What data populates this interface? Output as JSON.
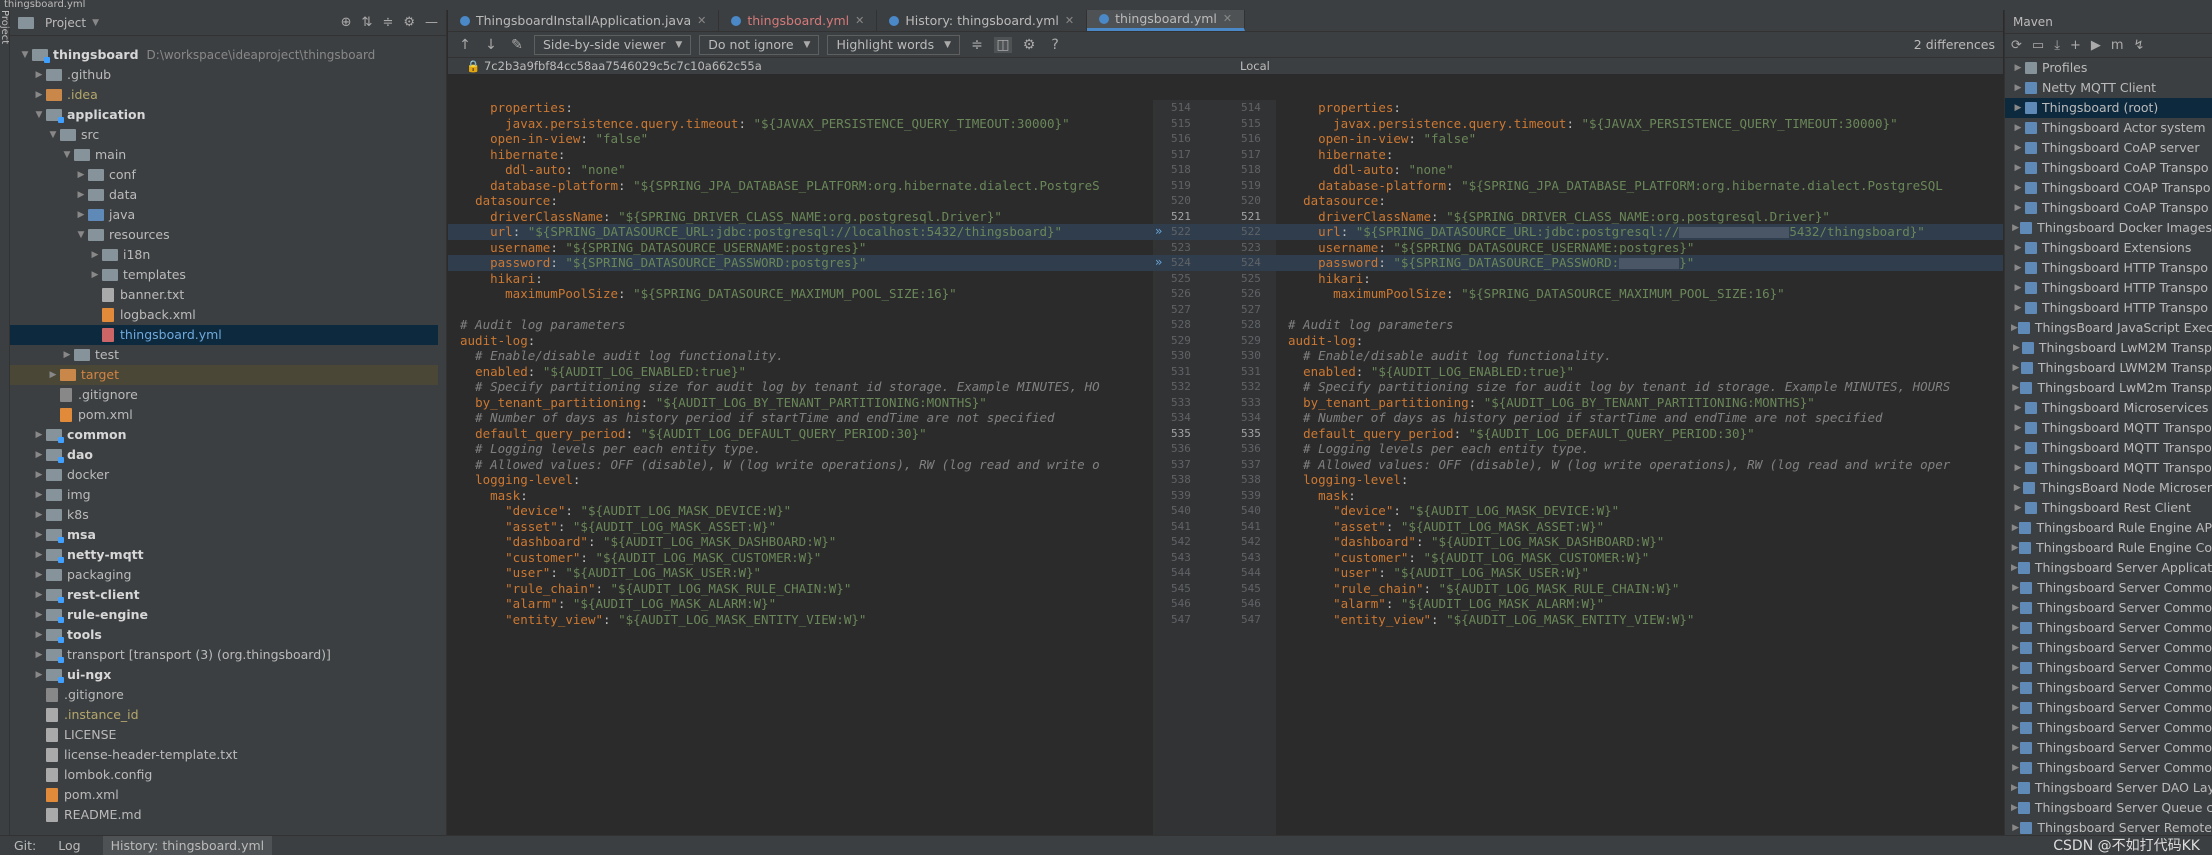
{
  "window": {
    "title": "thingsboard.yml",
    "left_strip": "Project"
  },
  "project": {
    "title": "Project",
    "tree": [
      {
        "depth": 0,
        "arrow": "v",
        "icon": "mod",
        "label": "thingsboard",
        "path": "D:\\workspace\\ideaproject\\thingsboard",
        "style": "bold"
      },
      {
        "depth": 1,
        "arrow": ">",
        "icon": "fold",
        "label": ".github"
      },
      {
        "depth": 1,
        "arrow": ">",
        "icon": "orange",
        "label": ".idea",
        "style": "olive"
      },
      {
        "depth": 1,
        "arrow": "v",
        "icon": "mod",
        "label": "application",
        "style": "bold"
      },
      {
        "depth": 2,
        "arrow": "v",
        "icon": "fold",
        "label": "src"
      },
      {
        "depth": 3,
        "arrow": "v",
        "icon": "fold",
        "label": "main"
      },
      {
        "depth": 4,
        "arrow": ">",
        "icon": "fold",
        "label": "conf"
      },
      {
        "depth": 4,
        "arrow": ">",
        "icon": "fold",
        "label": "data"
      },
      {
        "depth": 4,
        "arrow": ">",
        "icon": "blue",
        "label": "java"
      },
      {
        "depth": 4,
        "arrow": "v",
        "icon": "fold",
        "label": "resources"
      },
      {
        "depth": 5,
        "arrow": ">",
        "icon": "fold",
        "label": "i18n"
      },
      {
        "depth": 5,
        "arrow": ">",
        "icon": "fold",
        "label": "templates"
      },
      {
        "depth": 5,
        "arrow": "",
        "icon": "txt",
        "label": "banner.txt"
      },
      {
        "depth": 5,
        "arrow": "",
        "icon": "xml",
        "label": "logback.xml"
      },
      {
        "depth": 5,
        "arrow": "",
        "icon": "yml",
        "label": "thingsboard.yml",
        "style": "blue-t",
        "selected": true
      },
      {
        "depth": 3,
        "arrow": ">",
        "icon": "fold",
        "label": "test"
      },
      {
        "depth": 2,
        "arrow": ">",
        "icon": "orange",
        "label": "target",
        "style": "orange-t",
        "target": true
      },
      {
        "depth": 2,
        "arrow": "",
        "icon": "git",
        "label": ".gitignore"
      },
      {
        "depth": 2,
        "arrow": "",
        "icon": "xml",
        "label": "pom.xml"
      },
      {
        "depth": 1,
        "arrow": ">",
        "icon": "mod",
        "label": "common",
        "style": "bold"
      },
      {
        "depth": 1,
        "arrow": ">",
        "icon": "mod",
        "label": "dao",
        "style": "bold"
      },
      {
        "depth": 1,
        "arrow": ">",
        "icon": "fold",
        "label": "docker"
      },
      {
        "depth": 1,
        "arrow": ">",
        "icon": "fold",
        "label": "img"
      },
      {
        "depth": 1,
        "arrow": ">",
        "icon": "fold",
        "label": "k8s"
      },
      {
        "depth": 1,
        "arrow": ">",
        "icon": "mod",
        "label": "msa",
        "style": "bold"
      },
      {
        "depth": 1,
        "arrow": ">",
        "icon": "mod",
        "label": "netty-mqtt",
        "style": "bold"
      },
      {
        "depth": 1,
        "arrow": ">",
        "icon": "fold",
        "label": "packaging"
      },
      {
        "depth": 1,
        "arrow": ">",
        "icon": "mod",
        "label": "rest-client",
        "style": "bold"
      },
      {
        "depth": 1,
        "arrow": ">",
        "icon": "mod",
        "label": "rule-engine",
        "style": "bold"
      },
      {
        "depth": 1,
        "arrow": ">",
        "icon": "mod",
        "label": "tools",
        "style": "bold"
      },
      {
        "depth": 1,
        "arrow": ">",
        "icon": "mod",
        "label": "transport [transport (3) (org.thingsboard)]"
      },
      {
        "depth": 1,
        "arrow": ">",
        "icon": "mod",
        "label": "ui-ngx",
        "style": "bold"
      },
      {
        "depth": 1,
        "arrow": "",
        "icon": "git",
        "label": ".gitignore"
      },
      {
        "depth": 1,
        "arrow": "",
        "icon": "txt",
        "label": ".instance_id",
        "style": "olive"
      },
      {
        "depth": 1,
        "arrow": "",
        "icon": "txt",
        "label": "LICENSE"
      },
      {
        "depth": 1,
        "arrow": "",
        "icon": "txt",
        "label": "license-header-template.txt"
      },
      {
        "depth": 1,
        "arrow": "",
        "icon": "txt",
        "label": "lombok.config"
      },
      {
        "depth": 1,
        "arrow": "",
        "icon": "xml",
        "label": "pom.xml"
      },
      {
        "depth": 1,
        "arrow": "",
        "icon": "txt",
        "label": "README.md"
      }
    ]
  },
  "tabs": [
    {
      "label": "ThingsboardInstallApplication.java",
      "style": ""
    },
    {
      "label": "thingsboard.yml",
      "style": "red"
    },
    {
      "label": "History: thingsboard.yml",
      "style": ""
    },
    {
      "label": "thingsboard.yml",
      "style": "active"
    }
  ],
  "toolbar": {
    "viewer": "Side-by-side viewer",
    "ignore": "Do not ignore",
    "highlight": "Highlight words",
    "help": "?",
    "differences": "2 differences"
  },
  "diff": {
    "revision": "7c2b3a9fbf84cc58aa7546029c5c7c10a662c55a",
    "local": "Local",
    "left_numbers": [
      "514",
      "515",
      "516",
      "517",
      "518",
      "519",
      "520",
      "521",
      "522",
      "523",
      "524",
      "525",
      "526",
      "527",
      "528",
      "529",
      "530",
      "531",
      "532",
      "533",
      "534",
      "535",
      "536",
      "537",
      "538",
      "539",
      "540",
      "541",
      "542",
      "543",
      "544",
      "545",
      "546",
      "547"
    ],
    "right_numbers": [
      "514",
      "515",
      "516",
      "517",
      "518",
      "519",
      "520",
      "521",
      "522",
      "523",
      "524",
      "525",
      "526",
      "527",
      "528",
      "529",
      "530",
      "531",
      "532",
      "533",
      "534",
      "535",
      "536",
      "537",
      "538",
      "539",
      "540",
      "541",
      "542",
      "543",
      "544",
      "545",
      "546",
      "547"
    ],
    "left_lines": [
      "    properties:",
      "      javax.persistence.query.timeout: \"${JAVAX_PERSISTENCE_QUERY_TIMEOUT:30000}\"",
      "    open-in-view: \"false\"",
      "    hibernate:",
      "      ddl-auto: \"none\"",
      "    database-platform: \"${SPRING_JPA_DATABASE_PLATFORM:org.hibernate.dialect.PostgreS",
      "  datasource:",
      "    driverClassName: \"${SPRING_DRIVER_CLASS_NAME:org.postgresql.Driver}\"",
      "    url: \"${SPRING_DATASOURCE_URL:jdbc:postgresql://localhost:5432/thingsboard}\"",
      "    username: \"${SPRING_DATASOURCE_USERNAME:postgres}\"",
      "    password: \"${SPRING_DATASOURCE_PASSWORD:postgres}\"",
      "    hikari:",
      "      maximumPoolSize: \"${SPRING_DATASOURCE_MAXIMUM_POOL_SIZE:16}\"",
      "",
      "# Audit log parameters",
      "audit-log:",
      "  # Enable/disable audit log functionality.",
      "  enabled: \"${AUDIT_LOG_ENABLED:true}\"",
      "  # Specify partitioning size for audit log by tenant id storage. Example MINUTES, HO",
      "  by_tenant_partitioning: \"${AUDIT_LOG_BY_TENANT_PARTITIONING:MONTHS}\"",
      "  # Number of days as history period if startTime and endTime are not specified",
      "  default_query_period: \"${AUDIT_LOG_DEFAULT_QUERY_PERIOD:30}\"",
      "  # Logging levels per each entity type.",
      "  # Allowed values: OFF (disable), W (log write operations), RW (log read and write o",
      "  logging-level:",
      "    mask:",
      "      \"device\": \"${AUDIT_LOG_MASK_DEVICE:W}\"",
      "      \"asset\": \"${AUDIT_LOG_MASK_ASSET:W}\"",
      "      \"dashboard\": \"${AUDIT_LOG_MASK_DASHBOARD:W}\"",
      "      \"customer\": \"${AUDIT_LOG_MASK_CUSTOMER:W}\"",
      "      \"user\": \"${AUDIT_LOG_MASK_USER:W}\"",
      "      \"rule_chain\": \"${AUDIT_LOG_MASK_RULE_CHAIN:W}\"",
      "      \"alarm\": \"${AUDIT_LOG_MASK_ALARM:W}\"",
      "      \"entity_view\": \"${AUDIT_LOG_MASK_ENTITY_VIEW:W}\""
    ],
    "right_lines": [
      "    properties:",
      "      javax.persistence.query.timeout: \"${JAVAX_PERSISTENCE_QUERY_TIMEOUT:30000}\"",
      "    open-in-view: \"false\"",
      "    hibernate:",
      "      ddl-auto: \"none\"",
      "    database-platform: \"${SPRING_JPA_DATABASE_PLATFORM:org.hibernate.dialect.PostgreSQL",
      "  datasource:",
      "    driverClassName: \"${SPRING_DRIVER_CLASS_NAME:org.postgresql.Driver}\"",
      "    url: \"${SPRING_DATASOURCE_URL:jdbc:postgresql://",
      "    username: \"${SPRING_DATASOURCE_USERNAME:postgres}\"",
      "    password: \"${SPRING_DATASOURCE_PASSWORD:",
      "    hikari:",
      "      maximumPoolSize: \"${SPRING_DATASOURCE_MAXIMUM_POOL_SIZE:16}\"",
      "",
      "# Audit log parameters",
      "audit-log:",
      "  # Enable/disable audit log functionality.",
      "  enabled: \"${AUDIT_LOG_ENABLED:true}\"",
      "  # Specify partitioning size for audit log by tenant id storage. Example MINUTES, HOURS",
      "  by_tenant_partitioning: \"${AUDIT_LOG_BY_TENANT_PARTITIONING:MONTHS}\"",
      "  # Number of days as history period if startTime and endTime are not specified",
      "  default_query_period: \"${AUDIT_LOG_DEFAULT_QUERY_PERIOD:30}\"",
      "  # Logging levels per each entity type.",
      "  # Allowed values: OFF (disable), W (log write operations), RW (log read and write oper",
      "  logging-level:",
      "    mask:",
      "      \"device\": \"${AUDIT_LOG_MASK_DEVICE:W}\"",
      "      \"asset\": \"${AUDIT_LOG_MASK_ASSET:W}\"",
      "      \"dashboard\": \"${AUDIT_LOG_MASK_DASHBOARD:W}\"",
      "      \"customer\": \"${AUDIT_LOG_MASK_CUSTOMER:W}\"",
      "      \"user\": \"${AUDIT_LOG_MASK_USER:W}\"",
      "      \"rule_chain\": \"${AUDIT_LOG_MASK_RULE_CHAIN:W}\"",
      "      \"alarm\": \"${AUDIT_LOG_MASK_ALARM:W}\"",
      "      \"entity_view\": \"${AUDIT_LOG_MASK_ENTITY_VIEW:W}\""
    ],
    "right_url_tail": "5432/thingsboard}\"",
    "right_password_tail": "}\""
  },
  "maven": {
    "title": "Maven",
    "items": [
      {
        "label": "Profiles",
        "icon": "folder"
      },
      {
        "label": "Netty MQTT Client"
      },
      {
        "label": "Thingsboard (root)",
        "selected": true
      },
      {
        "label": "Thingsboard Actor system"
      },
      {
        "label": "Thingsboard CoAP server"
      },
      {
        "label": "Thingsboard CoAP Transpo"
      },
      {
        "label": "Thingsboard COAP Transpo"
      },
      {
        "label": "Thingsboard CoAP Transpo"
      },
      {
        "label": "Thingsboard Docker Images"
      },
      {
        "label": "Thingsboard Extensions"
      },
      {
        "label": "Thingsboard HTTP Transpo"
      },
      {
        "label": "Thingsboard HTTP Transpo"
      },
      {
        "label": "Thingsboard HTTP Transpo"
      },
      {
        "label": "ThingsBoard JavaScript Exec"
      },
      {
        "label": "Thingsboard LwM2M Transp"
      },
      {
        "label": "Thingsboard LWM2M Transp"
      },
      {
        "label": "Thingsboard LwM2m Transp"
      },
      {
        "label": "Thingsboard Microservices"
      },
      {
        "label": "Thingsboard MQTT Transpo"
      },
      {
        "label": "Thingsboard MQTT Transpo"
      },
      {
        "label": "Thingsboard MQTT Transpo"
      },
      {
        "label": "ThingsBoard Node Microser"
      },
      {
        "label": "Thingsboard Rest Client"
      },
      {
        "label": "Thingsboard Rule Engine AP"
      },
      {
        "label": "Thingsboard Rule Engine Co"
      },
      {
        "label": "Thingsboard Server Applicat"
      },
      {
        "label": "Thingsboard Server Commo"
      },
      {
        "label": "Thingsboard Server Commo"
      },
      {
        "label": "Thingsboard Server Commo"
      },
      {
        "label": "Thingsboard Server Commo"
      },
      {
        "label": "Thingsboard Server Commo"
      },
      {
        "label": "Thingsboard Server Commo"
      },
      {
        "label": "Thingsboard Server Commo"
      },
      {
        "label": "Thingsboard Server Commo"
      },
      {
        "label": "Thingsboard Server Commo"
      },
      {
        "label": "Thingsboard Server Commo"
      },
      {
        "label": "Thingsboard Server DAO Lay"
      },
      {
        "label": "Thingsboard Server Queue c"
      },
      {
        "label": "Thingsboard Server Remote"
      }
    ]
  },
  "bottom": {
    "git": "Git:",
    "log": "Log",
    "history": "History: thingsboard.yml",
    "watermark": "CSDN @不如打代码KK"
  }
}
